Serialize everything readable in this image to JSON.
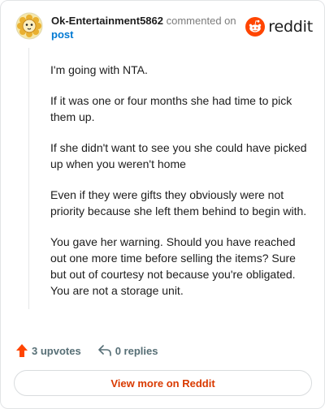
{
  "header": {
    "username": "Ok-Entertainment5862",
    "action_text": "commented on",
    "post_link": "post",
    "brand_name": "reddit"
  },
  "comment": {
    "paragraphs": [
      "I'm going with NTA.",
      "If it was one or four months she had time to pick them up.",
      "If she didn't want to see you she could have picked up when you weren't home",
      "Even if they were gifts they obviously were not priority because she left them behind to begin with.",
      "You gave her warning. Should you have reached out one more time before selling the items? Sure but out of courtesy not because you're obligated. You are not a storage unit."
    ]
  },
  "actions": {
    "upvotes": "3 upvotes",
    "replies": "0 replies"
  },
  "footer": {
    "view_more": "View more on Reddit"
  },
  "colors": {
    "brand": "#ff4500",
    "link": "#0079d3",
    "view_more_text": "#d93a00",
    "muted": "#576f76"
  },
  "icons": {
    "avatar": "lion-avatar-icon",
    "brand": "reddit-snoo-icon",
    "upvote": "upvote-arrow-icon",
    "reply": "reply-arrow-icon"
  }
}
